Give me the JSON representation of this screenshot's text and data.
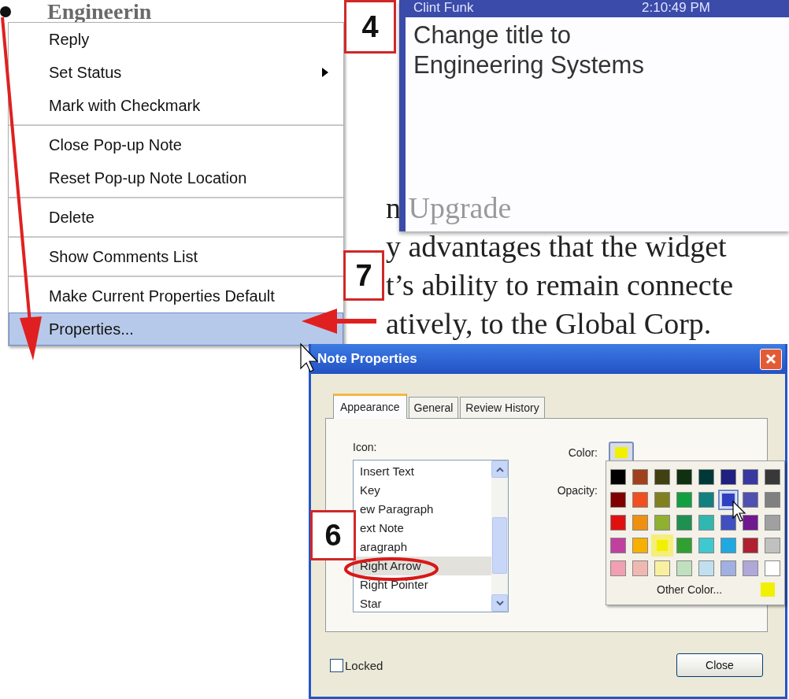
{
  "document": {
    "heading": "Engineerin",
    "lines": [
      "n Upgrade",
      "y advantages that the widget",
      "t’s ability to remain connecte",
      "atively, to the Global Corp."
    ]
  },
  "note": {
    "author": "Clint Funk",
    "time": "2:10:49 PM",
    "lines": [
      "Change title to",
      "Engineering Systems"
    ]
  },
  "context_menu": {
    "groups": [
      [
        {
          "label": "Reply",
          "submenu": false,
          "selected": false
        },
        {
          "label": "Set Status",
          "submenu": true,
          "selected": false
        },
        {
          "label": "Mark with Checkmark",
          "submenu": false,
          "selected": false
        }
      ],
      [
        {
          "label": "Close Pop-up Note",
          "submenu": false,
          "selected": false
        },
        {
          "label": "Reset Pop-up Note Location",
          "submenu": false,
          "selected": false
        }
      ],
      [
        {
          "label": "Delete",
          "submenu": false,
          "selected": false
        }
      ],
      [
        {
          "label": "Show Comments List",
          "submenu": false,
          "selected": false
        }
      ],
      [
        {
          "label": "Make Current Properties Default",
          "submenu": false,
          "selected": false
        },
        {
          "label": "Properties...",
          "submenu": false,
          "selected": true
        }
      ]
    ]
  },
  "callouts": [
    {
      "label": "4"
    },
    {
      "label": "7"
    },
    {
      "label": "6"
    }
  ],
  "dialog": {
    "title": "Note Properties",
    "tabs": [
      {
        "label": "Appearance",
        "selected": true
      },
      {
        "label": "General",
        "selected": false
      },
      {
        "label": "Review History",
        "selected": false
      }
    ],
    "icon_label": "Icon:",
    "icon_list": [
      {
        "label": "Insert Text",
        "selected": false
      },
      {
        "label": "Key",
        "selected": false
      },
      {
        "label": "ew Paragraph",
        "selected": false
      },
      {
        "label": "ext Note",
        "selected": false
      },
      {
        "label": "aragraph",
        "selected": false
      },
      {
        "label": "Right Arrow",
        "selected": true
      },
      {
        "label": "Right Pointer",
        "selected": false
      },
      {
        "label": "Star",
        "selected": false
      }
    ],
    "color_label": "Color:",
    "color": "#f0f000",
    "opacity_label": "Opacity:",
    "palette": {
      "swatches": [
        {
          "color": "#000000",
          "selected": false,
          "hovered": false
        },
        {
          "color": "#a0401c",
          "selected": false,
          "hovered": false
        },
        {
          "color": "#404010",
          "selected": false,
          "hovered": false
        },
        {
          "color": "#103010",
          "selected": false,
          "hovered": false
        },
        {
          "color": "#003838",
          "selected": false,
          "hovered": false
        },
        {
          "color": "#202080",
          "selected": false,
          "hovered": false
        },
        {
          "color": "#3838a0",
          "selected": false,
          "hovered": false
        },
        {
          "color": "#383838",
          "selected": false,
          "hovered": false
        },
        {
          "color": "#800000",
          "selected": false,
          "hovered": false
        },
        {
          "color": "#f05020",
          "selected": false,
          "hovered": false
        },
        {
          "color": "#808020",
          "selected": false,
          "hovered": false
        },
        {
          "color": "#10a040",
          "selected": false,
          "hovered": false
        },
        {
          "color": "#108080",
          "selected": false,
          "hovered": false
        },
        {
          "color": "#3040c0",
          "selected": false,
          "hovered": true
        },
        {
          "color": "#5050b0",
          "selected": false,
          "hovered": false
        },
        {
          "color": "#808080",
          "selected": false,
          "hovered": false
        },
        {
          "color": "#e01010",
          "selected": false,
          "hovered": false
        },
        {
          "color": "#f09010",
          "selected": false,
          "hovered": false
        },
        {
          "color": "#90b030",
          "selected": false,
          "hovered": false
        },
        {
          "color": "#209050",
          "selected": false,
          "hovered": false
        },
        {
          "color": "#30b8b0",
          "selected": false,
          "hovered": false
        },
        {
          "color": "#4050c0",
          "selected": false,
          "hovered": false
        },
        {
          "color": "#701890",
          "selected": false,
          "hovered": false
        },
        {
          "color": "#a0a0a0",
          "selected": false,
          "hovered": false
        },
        {
          "color": "#c040a0",
          "selected": false,
          "hovered": false
        },
        {
          "color": "#f8b000",
          "selected": false,
          "hovered": false
        },
        {
          "color": "#f0f000",
          "selected": true,
          "hovered": false
        },
        {
          "color": "#30a030",
          "selected": false,
          "hovered": false
        },
        {
          "color": "#40c8d0",
          "selected": false,
          "hovered": false
        },
        {
          "color": "#20a8e0",
          "selected": false,
          "hovered": false
        },
        {
          "color": "#b02030",
          "selected": false,
          "hovered": false
        },
        {
          "color": "#c0c0c0",
          "selected": false,
          "hovered": false
        },
        {
          "color": "#f0a0b0",
          "selected": false,
          "hovered": false
        },
        {
          "color": "#f0b8b0",
          "selected": false,
          "hovered": false
        },
        {
          "color": "#f8f0a0",
          "selected": false,
          "hovered": false
        },
        {
          "color": "#c0e0c0",
          "selected": false,
          "hovered": false
        },
        {
          "color": "#c0e0f0",
          "selected": false,
          "hovered": false
        },
        {
          "color": "#a0b0e0",
          "selected": false,
          "hovered": false
        },
        {
          "color": "#b0a8d8",
          "selected": false,
          "hovered": false
        },
        {
          "color": "#ffffff",
          "selected": false,
          "hovered": false
        }
      ],
      "other": {
        "label": "Other Color...",
        "color": "#f0f000"
      }
    },
    "locked": {
      "label": "Locked",
      "checked": false
    },
    "close_button": "Close"
  }
}
